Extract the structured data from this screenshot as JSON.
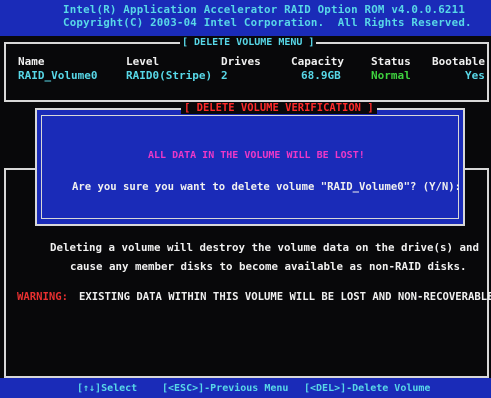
{
  "header": {
    "line1": "Intel(R) Application Accelerator RAID Option ROM v4.0.0.6211",
    "line2": "Copyright(C) 2003-04 Intel Corporation.  All Rights Reserved."
  },
  "menu": {
    "title": "[ DELETE VOLUME MENU ]",
    "columns": {
      "name": "Name",
      "level": "Level",
      "drives": "Drives",
      "capacity": "Capacity",
      "status": "Status",
      "bootable": "Bootable"
    },
    "row": {
      "name": "RAID_Volume0",
      "level": "RAID0(Stripe)",
      "drives": "2",
      "capacity": "68.9GB",
      "status": "Normal",
      "bootable": "Yes"
    }
  },
  "dialog": {
    "title": "[ DELETE VOLUME VERIFICATION ]",
    "warning_line": "ALL DATA IN THE VOLUME WILL BE LOST!",
    "prompt": "Are you sure you want to delete volume \"RAID_Volume0\"? (Y/N):"
  },
  "help": {
    "line1": "Deleting a volume will destroy the volume data on the drive(s) and",
    "line2": "cause any member disks to become available as non-RAID disks."
  },
  "warning": {
    "label": "WARNING:",
    "text": "EXISTING DATA WITHIN THIS VOLUME WILL BE LOST AND NON-RECOVERABLE."
  },
  "footer": {
    "select": "[↑↓]Select",
    "esc": "[<ESC>]-Previous Menu",
    "del": "[<DEL>]-Delete Volume"
  },
  "colors": {
    "background": "#08080a",
    "panel_blue": "#1a2bb8",
    "cyan_text": "#58d8e8",
    "status_green": "#3ed23e",
    "magenta_text": "#ee38c8",
    "warning_red": "#e83030"
  }
}
